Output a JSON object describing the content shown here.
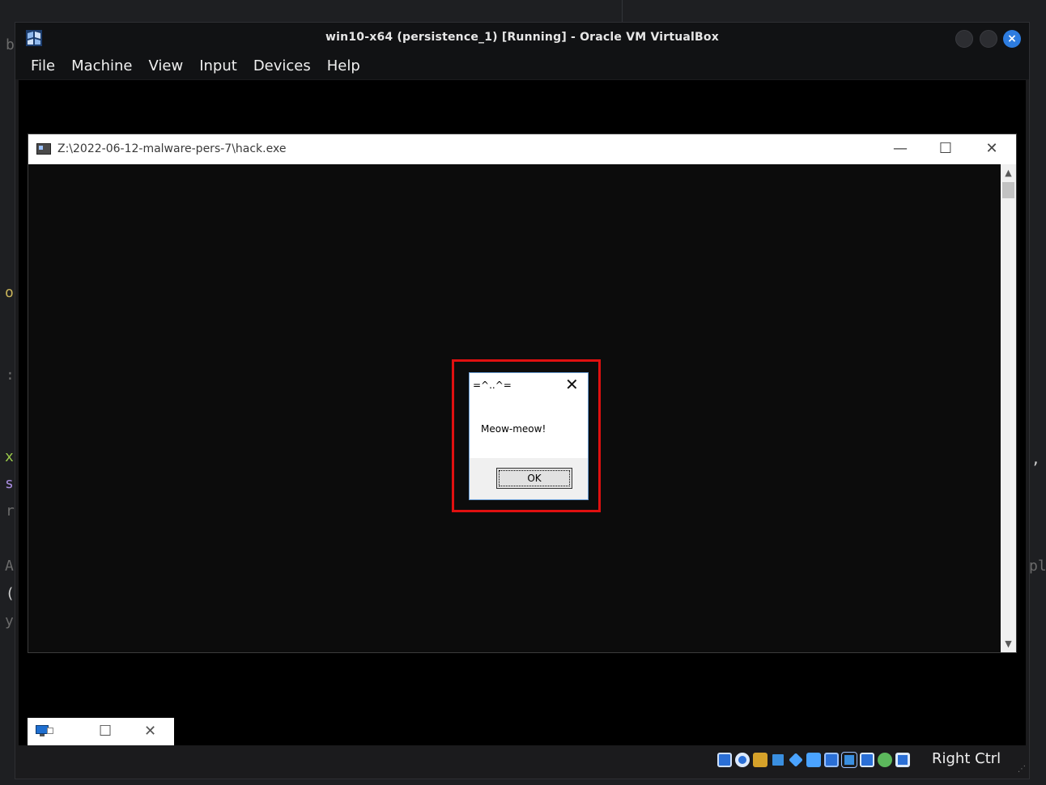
{
  "vbox": {
    "title": "win10-x64 (persistence_1) [Running] - Oracle VM VirtualBox",
    "menu": [
      "File",
      "Machine",
      "View",
      "Input",
      "Devices",
      "Help"
    ],
    "close_glyph": "×",
    "host_key": "Right Ctrl"
  },
  "console": {
    "title": "Z:\\2022-06-12-malware-pers-7\\hack.exe",
    "min_glyph": "—",
    "max_glyph": "☐",
    "close_glyph": "✕",
    "scroll_up": "▲",
    "scroll_down": "▼"
  },
  "msgbox": {
    "title": "=^..^=",
    "close_glyph": "✕",
    "text": "Meow-meow!",
    "ok_label": "OK",
    "highlight_color": "#e01010"
  },
  "mini_window": {
    "max_glyph": "☐",
    "close_glyph": "✕"
  },
  "background_editor": {
    "glyphs": [
      {
        "char": "b",
        "color": "#6b6b6b"
      },
      {
        "char": "o",
        "color": "#c8b35a"
      },
      {
        "char": ":",
        "color": "#6b6b6b"
      },
      {
        "char": "x",
        "color": "#9ac94a"
      },
      {
        "char": "s",
        "color": "#a98de0"
      },
      {
        "char": "r",
        "color": "#6b6b6b"
      },
      {
        "char": "A",
        "color": "#6b6b6b"
      },
      {
        "char": "(",
        "color": "#d0d0d0"
      },
      {
        "char": "y",
        "color": "#6b6b6b"
      },
      {
        "char": ",",
        "color": "#d0d0d0"
      },
      {
        "char": "pl",
        "color": "#6b6b6b"
      }
    ]
  },
  "status_icons": [
    "hdd-icon",
    "optical-icon",
    "audio-icon",
    "network-icon",
    "usb-icon",
    "shared-folder-icon",
    "display-icon",
    "recording-icon",
    "cpu-icon",
    "vt-icon",
    "mouse-integration-icon",
    "arrow-icon"
  ]
}
